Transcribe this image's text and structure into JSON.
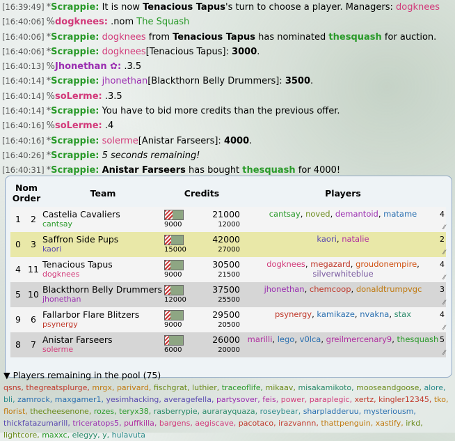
{
  "chat": [
    {
      "ts": "[16:39:49]",
      "rank": "*",
      "name": "Scrappie:",
      "name_color": "#2a9a2a",
      "parts": [
        {
          "t": " It is now "
        },
        {
          "t": "Tenacious Tapus",
          "b": true
        },
        {
          "t": "'s turn to choose a player. Managers: "
        },
        {
          "t": "dogknees",
          "c": "#d23a7a"
        }
      ]
    },
    {
      "ts": "[16:40:06]",
      "rank": "%",
      "name": "dogknees:",
      "name_color": "#d23a7a",
      "parts": [
        {
          "t": " .nom "
        },
        {
          "t": "The Squash",
          "c": "#2a9a2a"
        }
      ]
    },
    {
      "ts": "[16:40:06]",
      "rank": "*",
      "name": "Scrappie:",
      "name_color": "#2a9a2a",
      "parts": [
        {
          "t": " "
        },
        {
          "t": "dogknees",
          "c": "#d23a7a"
        },
        {
          "t": " from "
        },
        {
          "t": "Tenacious Tapus",
          "b": true
        },
        {
          "t": " has nominated "
        },
        {
          "t": "thesquash",
          "b": true,
          "c": "#2a9a2a"
        },
        {
          "t": " for auction."
        }
      ]
    },
    {
      "ts": "[16:40:06]",
      "rank": "*",
      "name": "Scrappie:",
      "name_color": "#2a9a2a",
      "parts": [
        {
          "t": " "
        },
        {
          "t": "dogknees",
          "c": "#d23a7a"
        },
        {
          "t": "[Tenacious Tapus]: "
        },
        {
          "t": "3000",
          "b": true
        },
        {
          "t": "."
        }
      ]
    },
    {
      "ts": "[16:40:13]",
      "rank": "%",
      "name": "Jhonethan ✿:",
      "name_color": "#9b2fb1",
      "parts": [
        {
          "t": " .3.5"
        }
      ]
    },
    {
      "ts": "[16:40:14]",
      "rank": "*",
      "name": "Scrappie:",
      "name_color": "#2a9a2a",
      "parts": [
        {
          "t": " "
        },
        {
          "t": "jhonethan",
          "c": "#9b2fb1"
        },
        {
          "t": "[Blackthorn Belly Drummers]: "
        },
        {
          "t": "3500",
          "b": true
        },
        {
          "t": "."
        }
      ]
    },
    {
      "ts": "[16:40:14]",
      "rank": "%",
      "name": "soLerme:",
      "name_color": "#d23a7a",
      "parts": [
        {
          "t": " .3.5"
        }
      ]
    },
    {
      "ts": "[16:40:14]",
      "rank": "*",
      "name": "Scrappie:",
      "name_color": "#2a9a2a",
      "parts": [
        {
          "t": " You have to bid more credits than the previous offer."
        }
      ]
    },
    {
      "ts": "[16:40:16]",
      "rank": "%",
      "name": "soLerme:",
      "name_color": "#d23a7a",
      "parts": [
        {
          "t": " .4"
        }
      ]
    },
    {
      "ts": "[16:40:16]",
      "rank": "*",
      "name": "Scrappie:",
      "name_color": "#2a9a2a",
      "parts": [
        {
          "t": " "
        },
        {
          "t": "solerme",
          "c": "#d23a7a"
        },
        {
          "t": "[Anistar Farseers]: "
        },
        {
          "t": "4000",
          "b": true
        },
        {
          "t": "."
        }
      ]
    },
    {
      "ts": "[16:40:26]",
      "rank": "*",
      "name": "Scrappie:",
      "name_color": "#2a9a2a",
      "parts": [
        {
          "t": " "
        },
        {
          "t": "5 seconds remaining!",
          "i": true
        }
      ]
    },
    {
      "ts": "[16:40:31]",
      "rank": "*",
      "name": "Scrappie:",
      "name_color": "#2a9a2a",
      "parts": [
        {
          "t": " "
        },
        {
          "t": "Anistar Farseers",
          "b": true
        },
        {
          "t": " has bought "
        },
        {
          "t": "thesquash",
          "b": true,
          "c": "#2a9a2a"
        },
        {
          "t": " for 4000!"
        }
      ]
    }
  ],
  "table": {
    "headers": {
      "nom": "Nom",
      "order": "Order",
      "team": "Team",
      "credits": "Credits",
      "players": "Players"
    },
    "rows": [
      {
        "nom": "1",
        "order": "2",
        "team": "Castelia Cavaliers",
        "manager": "cantsay",
        "manager_color": "#2a9a2a",
        "credits": "21000",
        "bid_limit": "9000",
        "max_bid": "12000",
        "spent_fraction": 0.43,
        "count": "4",
        "bg": "bg-white",
        "players": [
          {
            "n": "cantsay",
            "c": "#2a9a2a"
          },
          {
            "n": "noved",
            "c": "#6a8a1a"
          },
          {
            "n": "demantoid",
            "c": "#9b2fb1"
          },
          {
            "n": "matame",
            "c": "#2a6fb0"
          }
        ]
      },
      {
        "nom": "0",
        "order": "3",
        "team": "Saffron Side Pups",
        "manager": "kaori",
        "manager_color": "#5a4ab0",
        "credits": "42000",
        "bid_limit": "15000",
        "max_bid": "27000",
        "spent_fraction": 0.36,
        "count": "2",
        "bg": "bg-yellow",
        "players": [
          {
            "n": "kaori",
            "c": "#5a4ab0"
          },
          {
            "n": "natalie",
            "c": "#b02fa0"
          }
        ]
      },
      {
        "nom": "4",
        "order": "11",
        "team": "Tenacious Tapus",
        "manager": "dogknees",
        "manager_color": "#d23a7a",
        "credits": "30500",
        "bid_limit": "9000",
        "max_bid": "21500",
        "spent_fraction": 0.3,
        "count": "4",
        "bg": "bg-white",
        "players": [
          {
            "n": "dogknees",
            "c": "#d23a7a"
          },
          {
            "n": "megazard",
            "c": "#c0392b"
          },
          {
            "n": "groudonempire",
            "c": "#d05010"
          },
          {
            "n": "silverwhiteblue",
            "c": "#7a5aa0"
          }
        ]
      },
      {
        "nom": "5",
        "order": "10",
        "team": "Blackthorn Belly Drummers",
        "manager": "jhonethan",
        "manager_color": "#9b2fb1",
        "credits": "37500",
        "bid_limit": "12000",
        "max_bid": "25500",
        "spent_fraction": 0.32,
        "count": "3",
        "bg": "bg-gray",
        "players": [
          {
            "n": "jhonethan",
            "c": "#9b2fb1"
          },
          {
            "n": "chemcoop",
            "c": "#c0392b"
          },
          {
            "n": "donaldtrumpvgc",
            "c": "#c07a10"
          }
        ]
      },
      {
        "nom": "9",
        "order": "6",
        "team": "Fallarbor Flare Blitzers",
        "manager": "psynergy",
        "manager_color": "#c0392b",
        "credits": "29500",
        "bid_limit": "9000",
        "max_bid": "20500",
        "spent_fraction": 0.31,
        "count": "4",
        "bg": "bg-white",
        "players": [
          {
            "n": "psynergy",
            "c": "#c0392b"
          },
          {
            "n": "kamikaze",
            "c": "#2a6fb0"
          },
          {
            "n": "nvakna",
            "c": "#2a6fb0"
          },
          {
            "n": "stax",
            "c": "#2a8a6a"
          }
        ]
      },
      {
        "nom": "8",
        "order": "7",
        "team": "Anistar Farseers",
        "manager": "solerme",
        "manager_color": "#d23a7a",
        "credits": "26000",
        "bid_limit": "6000",
        "max_bid": "20000",
        "spent_fraction": 0.23,
        "count": "5",
        "bg": "bg-gray",
        "players": [
          {
            "n": "marilli",
            "c": "#b02fa0"
          },
          {
            "n": "lego",
            "c": "#2a6fb0"
          },
          {
            "n": "v0lca",
            "c": "#2a6fb0"
          },
          {
            "n": "greilmercenary9",
            "c": "#b02fa0"
          },
          {
            "n": "thesquash",
            "c": "#2a9a2a"
          }
        ]
      }
    ]
  },
  "pool": {
    "header": "▼ Players remaining in the pool (75)",
    "players": [
      {
        "n": "qsns",
        "c": "#c0392b"
      },
      {
        "n": "thegreatsplurge",
        "c": "#c0392b"
      },
      {
        "n": "mrgx",
        "c": "#c07a10"
      },
      {
        "n": "parivard",
        "c": "#c07a10"
      },
      {
        "n": "fischgrat",
        "c": "#6a8a1a"
      },
      {
        "n": "luthier",
        "c": "#6a8a1a"
      },
      {
        "n": "traceoflife",
        "c": "#2a9a2a"
      },
      {
        "n": "mikaav",
        "c": "#6a8a1a"
      },
      {
        "n": "misakamikoto",
        "c": "#2a8a6a"
      },
      {
        "n": "mooseandgoose",
        "c": "#6a8a1a"
      },
      {
        "n": "alore",
        "c": "#2a8a8a"
      },
      {
        "n": "bli",
        "c": "#2a8a8a"
      },
      {
        "n": "zamrock",
        "c": "#2a6fb0"
      },
      {
        "n": "maxgamer1",
        "c": "#2a6fb0"
      },
      {
        "n": "yesimhacking",
        "c": "#5a4ab0"
      },
      {
        "n": "averagefella",
        "c": "#5a4ab0"
      },
      {
        "n": "partysover",
        "c": "#9b2fb1"
      },
      {
        "n": "feis",
        "c": "#b02fa0"
      },
      {
        "n": "power",
        "c": "#d23a7a"
      },
      {
        "n": "paraplegic",
        "c": "#d23a7a"
      },
      {
        "n": "xertz",
        "c": "#c0392b"
      },
      {
        "n": "kingler12345",
        "c": "#c0392b"
      },
      {
        "n": "tko",
        "c": "#c07a10"
      },
      {
        "n": "florist",
        "c": "#c07a10"
      },
      {
        "n": "thecheesenone",
        "c": "#6a8a1a"
      },
      {
        "n": "rozes",
        "c": "#2a9a2a"
      },
      {
        "n": "teryx38",
        "c": "#2a9a2a"
      },
      {
        "n": "rasberrypie",
        "c": "#2a8a6a"
      },
      {
        "n": "aurarayquaza",
        "c": "#2a8a6a"
      },
      {
        "n": "roseybear",
        "c": "#2a8a8a"
      },
      {
        "n": "sharpladderuu",
        "c": "#2a6fb0"
      },
      {
        "n": "mysteriousm",
        "c": "#2a6fb0"
      },
      {
        "n": "thickfatazumarill",
        "c": "#5a4ab0"
      },
      {
        "n": "",
        "c": "#5a4ab0"
      },
      {
        "n": "triceratops5",
        "c": "#9b2fb1"
      },
      {
        "n": "puffkilla",
        "c": "#b02fa0"
      },
      {
        "n": "bargens",
        "c": "#d23a7a"
      },
      {
        "n": "aegiscave",
        "c": "#d23a7a"
      },
      {
        "n": "pacotaco",
        "c": "#c0392b"
      },
      {
        "n": "irazvannn",
        "c": "#c0392b"
      },
      {
        "n": "thattpenguin",
        "c": "#c07a10"
      },
      {
        "n": "xastify",
        "c": "#c07a10"
      },
      {
        "n": "irkd",
        "c": "#6a8a1a"
      },
      {
        "n": "lightcore",
        "c": "#6a8a1a"
      },
      {
        "n": "maxxc",
        "c": "#2a9a2a"
      },
      {
        "n": "elegyy",
        "c": "#2a8a6a"
      },
      {
        "n": "y",
        "c": "#2a8a6a"
      },
      {
        "n": "hulavuta",
        "c": "#2a8a8a"
      }
    ]
  }
}
